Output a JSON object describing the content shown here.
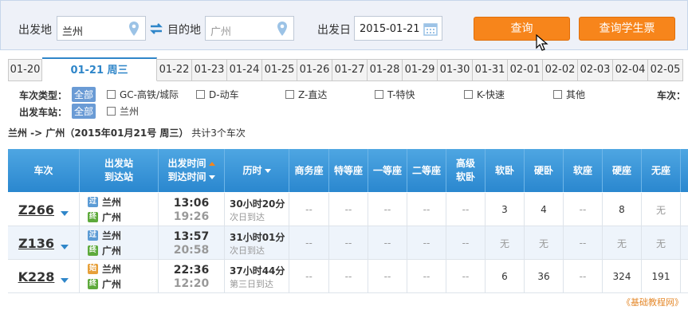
{
  "search": {
    "from_label": "出发地",
    "from_value": "兰州",
    "to_label": "目的地",
    "to_placeholder": "广州",
    "date_label": "出发日",
    "date_value": "2015-01-21",
    "query_button": "查询",
    "student_button": "查询学生票"
  },
  "date_tabs": [
    "01-20",
    "01-21 周三",
    "01-22",
    "01-23",
    "01-24",
    "01-25",
    "01-26",
    "01-27",
    "01-28",
    "01-29",
    "01-30",
    "01-31",
    "02-01",
    "02-02",
    "02-03",
    "02-04",
    "02-05"
  ],
  "filters": {
    "type_label": "车次类型：",
    "all_label": "全部",
    "types": [
      "GC-高铁/城际",
      "D-动车",
      "Z-直达",
      "T-特快",
      "K-快速",
      "其他"
    ],
    "right_label": "车次：",
    "station_label": "出发车站：",
    "stations": [
      "兰州"
    ]
  },
  "summary": {
    "route": "兰州 -> 广州（2015年01月21号 周三）",
    "count": "共计3个车次"
  },
  "table": {
    "headers": {
      "train": "车次",
      "station_top": "出发站",
      "station_bottom": "到达站",
      "time_top": "出发时间",
      "time_bottom": "到达时间",
      "duration": "历时",
      "business": "商务座",
      "special": "特等座",
      "first": "一等座",
      "second": "二等座",
      "premium_top": "高级",
      "premium_bottom": "软卧",
      "soft_sleeper": "软卧",
      "hard_sleeper": "硬卧",
      "soft_seat": "软座",
      "hard_seat": "硬座",
      "no_seat": "无座"
    },
    "rows": [
      {
        "train": "Z266",
        "from_badge": "过",
        "from": "兰州",
        "to_badge": "终",
        "to": "广州",
        "depart": "13:06",
        "arrive": "19:26",
        "duration": "30小时20分",
        "arrival_day": "次日到达",
        "business": "--",
        "special": "--",
        "first": "--",
        "second": "--",
        "premium": "--",
        "soft_sleeper": "3",
        "hard_sleeper": "4",
        "soft_seat": "--",
        "hard_seat": "8",
        "no_seat": "无"
      },
      {
        "train": "Z136",
        "from_badge": "过",
        "from": "兰州",
        "to_badge": "终",
        "to": "广州",
        "depart": "13:57",
        "arrive": "20:58",
        "duration": "31小时01分",
        "arrival_day": "次日到达",
        "business": "--",
        "special": "--",
        "first": "--",
        "second": "--",
        "premium": "--",
        "soft_sleeper": "无",
        "hard_sleeper": "无",
        "soft_seat": "--",
        "hard_seat": "无",
        "no_seat": "无"
      },
      {
        "train": "K228",
        "from_badge": "始",
        "from": "兰州",
        "to_badge": "终",
        "to": "广州",
        "depart": "22:36",
        "arrive": "12:20",
        "duration": "37小时44分",
        "arrival_day": "第三日到达",
        "business": "--",
        "special": "--",
        "first": "--",
        "second": "--",
        "premium": "--",
        "soft_sleeper": "6",
        "hard_sleeper": "36",
        "soft_seat": "--",
        "hard_seat": "324",
        "no_seat": "191"
      }
    ]
  },
  "watermark": "《基础教程网》"
}
